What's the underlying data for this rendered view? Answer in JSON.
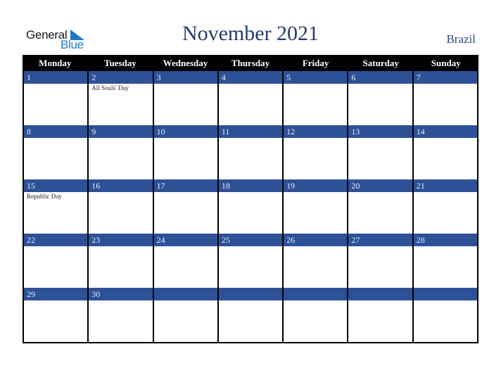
{
  "logo": {
    "general": "General",
    "blue": "Blue"
  },
  "title": "November 2021",
  "country": "Brazil",
  "weekdays": [
    "Monday",
    "Tuesday",
    "Wednesday",
    "Thursday",
    "Friday",
    "Saturday",
    "Sunday"
  ],
  "weeks": [
    [
      {
        "day": "1",
        "holiday": ""
      },
      {
        "day": "2",
        "holiday": "All Souls' Day"
      },
      {
        "day": "3",
        "holiday": ""
      },
      {
        "day": "4",
        "holiday": ""
      },
      {
        "day": "5",
        "holiday": ""
      },
      {
        "day": "6",
        "holiday": ""
      },
      {
        "day": "7",
        "holiday": ""
      }
    ],
    [
      {
        "day": "8",
        "holiday": ""
      },
      {
        "day": "9",
        "holiday": ""
      },
      {
        "day": "10",
        "holiday": ""
      },
      {
        "day": "11",
        "holiday": ""
      },
      {
        "day": "12",
        "holiday": ""
      },
      {
        "day": "13",
        "holiday": ""
      },
      {
        "day": "14",
        "holiday": ""
      }
    ],
    [
      {
        "day": "15",
        "holiday": "Republic Day"
      },
      {
        "day": "16",
        "holiday": ""
      },
      {
        "day": "17",
        "holiday": ""
      },
      {
        "day": "18",
        "holiday": ""
      },
      {
        "day": "19",
        "holiday": ""
      },
      {
        "day": "20",
        "holiday": ""
      },
      {
        "day": "21",
        "holiday": ""
      }
    ],
    [
      {
        "day": "22",
        "holiday": ""
      },
      {
        "day": "23",
        "holiday": ""
      },
      {
        "day": "24",
        "holiday": ""
      },
      {
        "day": "25",
        "holiday": ""
      },
      {
        "day": "26",
        "holiday": ""
      },
      {
        "day": "27",
        "holiday": ""
      },
      {
        "day": "28",
        "holiday": ""
      }
    ],
    [
      {
        "day": "29",
        "holiday": ""
      },
      {
        "day": "30",
        "holiday": ""
      },
      {
        "day": "",
        "holiday": ""
      },
      {
        "day": "",
        "holiday": ""
      },
      {
        "day": "",
        "holiday": ""
      },
      {
        "day": "",
        "holiday": ""
      },
      {
        "day": "",
        "holiday": ""
      }
    ]
  ],
  "colors": {
    "band": "#2d5196",
    "title": "#243b6b",
    "logo_blue": "#1f7ac6"
  }
}
